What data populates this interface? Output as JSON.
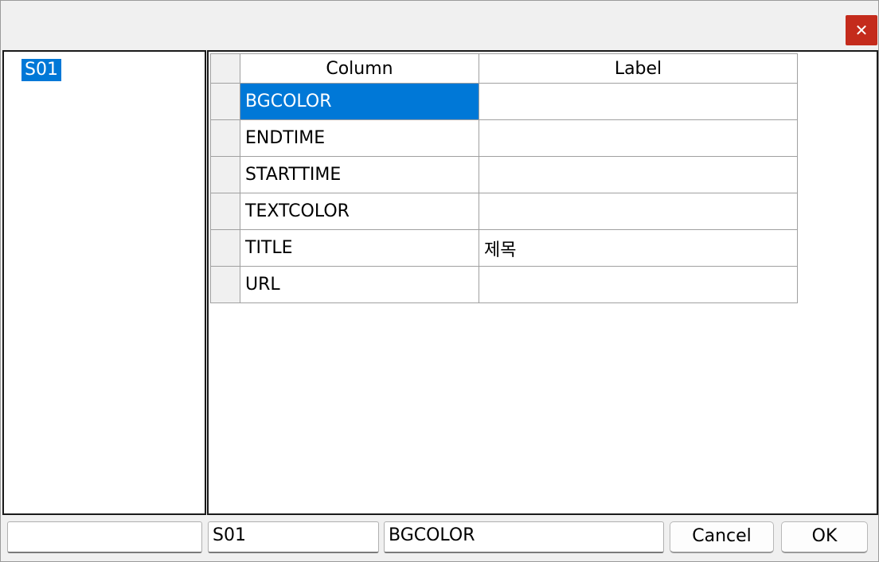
{
  "window": {
    "close_icon": "close-icon",
    "close_glyph": "✕"
  },
  "tree": {
    "items": [
      {
        "label": "S01",
        "selected": true
      }
    ]
  },
  "grid": {
    "headers": {
      "column": "Column",
      "label": "Label"
    },
    "rows": [
      {
        "column": "BGCOLOR",
        "label": "",
        "selected": true
      },
      {
        "column": "ENDTIME",
        "label": ""
      },
      {
        "column": "STARTTIME",
        "label": ""
      },
      {
        "column": "TEXTCOLOR",
        "label": ""
      },
      {
        "column": "TITLE",
        "label": "제목"
      },
      {
        "column": "URL",
        "label": ""
      }
    ]
  },
  "status": {
    "field1": "",
    "field2": "S01",
    "field3": "BGCOLOR"
  },
  "buttons": {
    "cancel": "Cancel",
    "ok": "OK"
  },
  "colors": {
    "selection": "#0078d7",
    "close_button": "#c42b1c"
  }
}
